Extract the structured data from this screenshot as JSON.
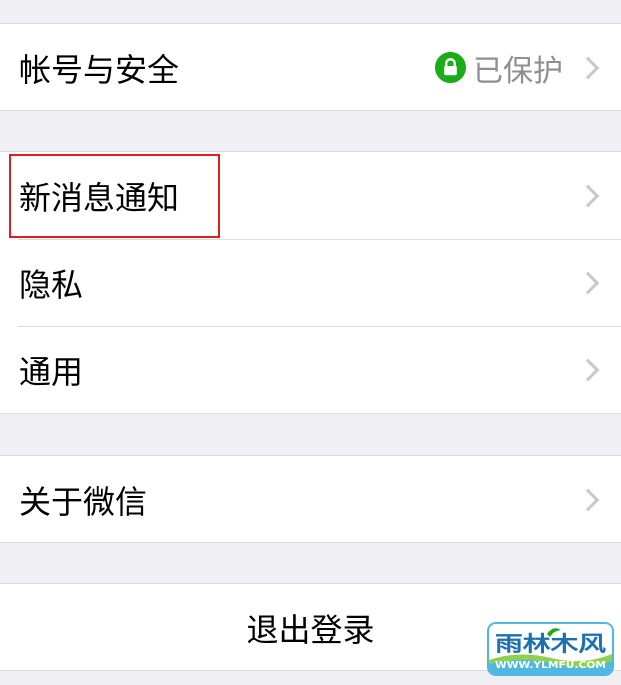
{
  "settings": {
    "account_security": {
      "label": "帐号与安全",
      "status": "已保护",
      "status_icon": "lock-icon",
      "status_color": "#1aad19"
    },
    "notifications": {
      "label": "新消息通知",
      "highlighted": true,
      "highlight_color": "#e02020"
    },
    "privacy": {
      "label": "隐私"
    },
    "general": {
      "label": "通用"
    },
    "about": {
      "label": "关于微信"
    },
    "logout": {
      "label": "退出登录"
    }
  },
  "watermark": {
    "brand": "雨林木风",
    "url": "WWW.YLMFU.COM"
  },
  "colors": {
    "background": "#efeff4",
    "cell": "#ffffff",
    "separator": "#dcdce0",
    "chevron": "#c7c7cc",
    "secondary_text": "#8e8e93"
  }
}
